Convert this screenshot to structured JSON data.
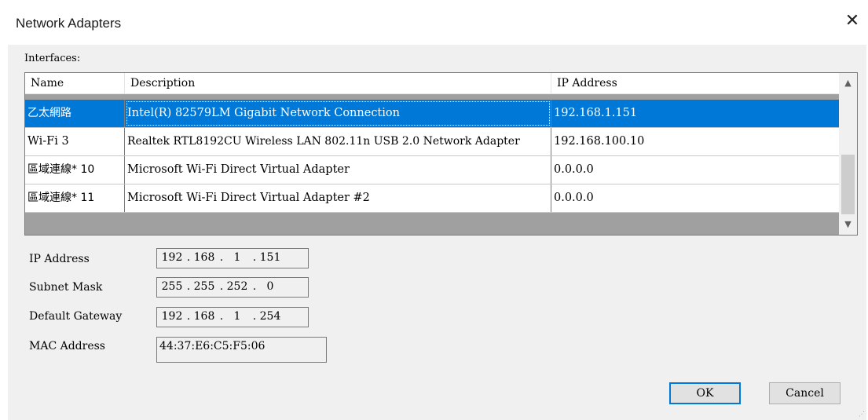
{
  "window": {
    "title": "Network Adapters"
  },
  "interfaces_label": "Interfaces:",
  "table": {
    "columns": [
      "Name",
      "Description",
      "IP Address"
    ],
    "rows": [
      {
        "name": "乙太網路",
        "description": "Intel(R) 82579LM Gigabit Network Connection",
        "ip": "192.168.1.151",
        "selected": true
      },
      {
        "name": "Wi-Fi 3",
        "description": "Realtek RTL8192CU Wireless LAN 802.11n USB 2.0 Network Adapter",
        "ip": "192.168.100.10",
        "selected": false
      },
      {
        "name": "區域連線* 10",
        "description": "Microsoft Wi-Fi Direct Virtual Adapter",
        "ip": "0.0.0.0",
        "selected": false
      },
      {
        "name": "區域連線* 11",
        "description": "Microsoft Wi-Fi Direct Virtual Adapter #2",
        "ip": "0.0.0.0",
        "selected": false
      }
    ]
  },
  "details": {
    "ip_label": "IP Address",
    "ip": [
      "192",
      "168",
      "1",
      "151"
    ],
    "subnet_label": "Subnet Mask",
    "subnet": [
      "255",
      "255",
      "252",
      "0"
    ],
    "gateway_label": "Default Gateway",
    "gateway": [
      "192",
      "168",
      "1",
      "254"
    ],
    "mac_label": "MAC Address",
    "mac": "44:37:E6:C5:F5:06"
  },
  "buttons": {
    "ok": "OK",
    "cancel": "Cancel"
  },
  "icons": {
    "close": "close-icon",
    "scroll_up": "chevron-up-icon",
    "scroll_down": "chevron-down-icon"
  },
  "colors": {
    "selection": "#0078d7",
    "dialog_bg": "#f0f0f0"
  }
}
